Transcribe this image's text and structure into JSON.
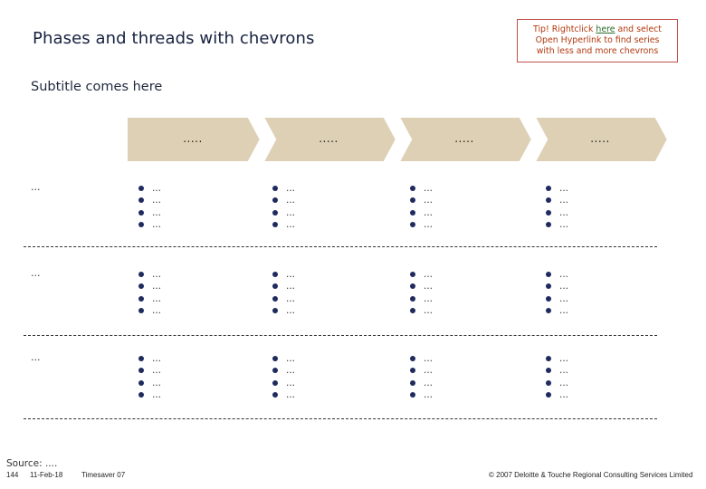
{
  "header": {
    "title": "Phases and threads with chevrons",
    "subtitle": "Subtitle comes here"
  },
  "tip": {
    "prefix": "Tip! Rightclick ",
    "link": "here",
    "middle": " and select",
    "line2": "Open Hyperlink to find series",
    "line3": "with less and more chevrons",
    "border_color": "#c0504d"
  },
  "chevrons": {
    "fill_color": "#ddd0b4",
    "items": [
      {
        "label": "....."
      },
      {
        "label": "....."
      },
      {
        "label": "....."
      },
      {
        "label": "....."
      }
    ]
  },
  "threads": [
    {
      "label": "...",
      "cells": [
        [
          "...",
          "...",
          "...",
          "..."
        ],
        [
          "...",
          "...",
          "...",
          "..."
        ],
        [
          "...",
          "...",
          "...",
          "..."
        ],
        [
          "...",
          "...",
          "...",
          "..."
        ]
      ]
    },
    {
      "label": "...",
      "cells": [
        [
          "...",
          "...",
          "...",
          "..."
        ],
        [
          "...",
          "...",
          "...",
          "..."
        ],
        [
          "...",
          "...",
          "...",
          "..."
        ],
        [
          "...",
          "...",
          "...",
          "..."
        ]
      ]
    },
    {
      "label": "...",
      "cells": [
        [
          "...",
          "...",
          "...",
          "..."
        ],
        [
          "...",
          "...",
          "...",
          "..."
        ],
        [
          "...",
          "...",
          "...",
          "..."
        ],
        [
          "...",
          "...",
          "...",
          "..."
        ]
      ]
    }
  ],
  "footer": {
    "source": "Source: ....",
    "page_number": "144",
    "date": "11-Feb-18",
    "template": "Timesaver 07",
    "copyright": "© 2007 Deloitte & Touche Regional Consulting Services Limited"
  }
}
